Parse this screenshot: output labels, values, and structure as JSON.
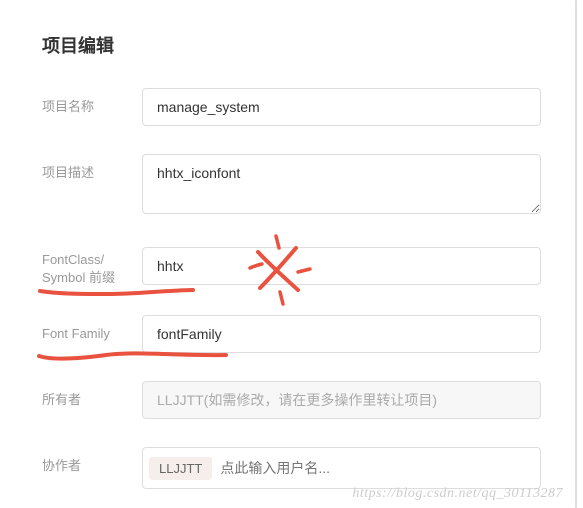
{
  "title": "项目编辑",
  "form": {
    "name_label": "项目名称",
    "name_value": "manage_system",
    "desc_label": "项目描述",
    "desc_value": "hhtx_iconfont",
    "fontclass_label_line1": "FontClass/",
    "fontclass_label_line2": "Symbol 前缀",
    "fontclass_value": "hhtx",
    "fontfamily_label": "Font Family",
    "fontfamily_value": "fontFamily",
    "owner_label": "所有者",
    "owner_value": "LLJJTT(如需修改，请在更多操作里转让项目)",
    "collab_label": "协作者",
    "collab_tag": "LLJJTT",
    "collab_placeholder": "点此输入用户名..."
  },
  "watermark": "https://blog.csdn.net/qq_30113287"
}
